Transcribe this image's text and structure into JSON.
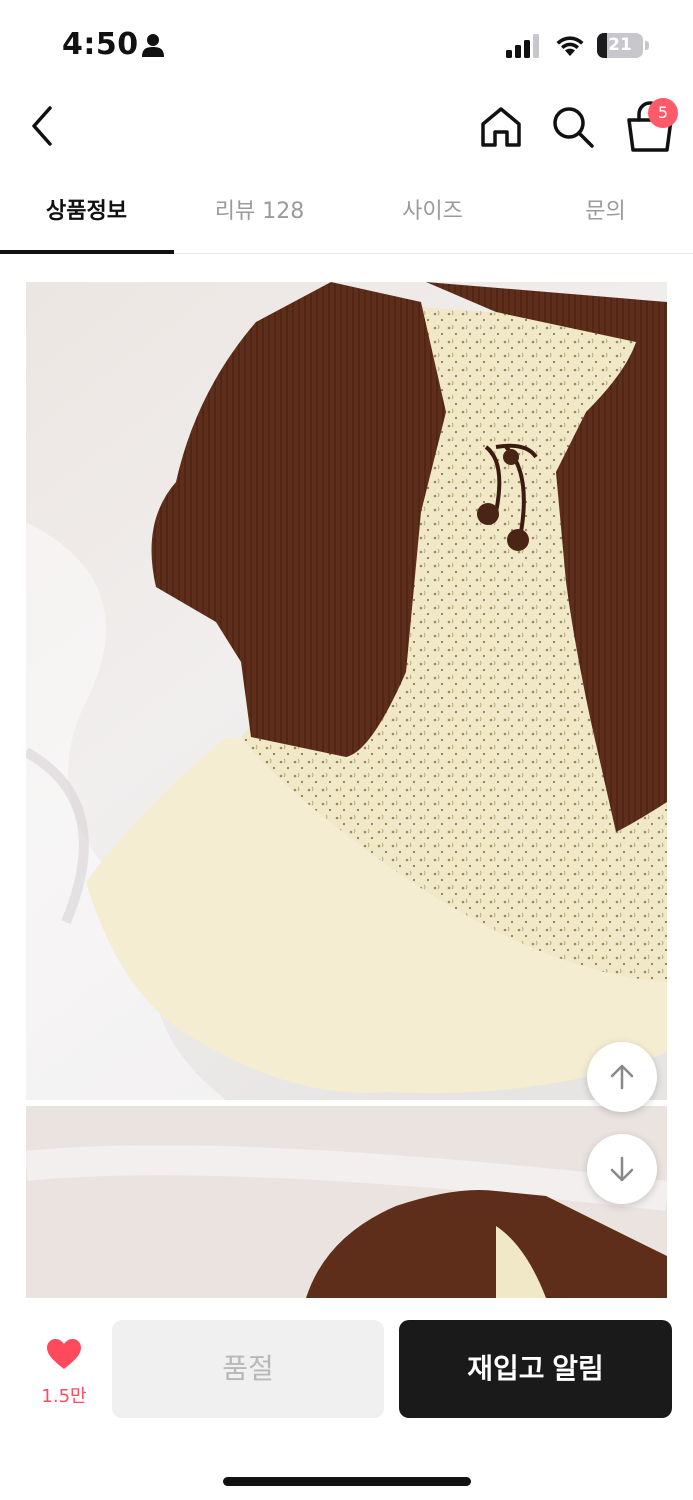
{
  "status_bar": {
    "time": "4:50",
    "battery": "21",
    "battery_level": 0.21
  },
  "nav": {
    "back_icon": "chevron-left-icon",
    "home_icon": "home-icon",
    "search_icon": "search-icon",
    "cart_icon": "shopping-bag-icon",
    "cart_badge": "5"
  },
  "tabs": [
    {
      "label": "상품정보",
      "active": true
    },
    {
      "label": "리뷰 128",
      "active": false
    },
    {
      "label": "사이즈",
      "active": false
    },
    {
      "label": "문의",
      "active": false
    }
  ],
  "bottom_bar": {
    "like_count": "1.5만",
    "soldout_label": "품절",
    "restock_label": "재입고 알림"
  },
  "colors": {
    "accent": "#ff4a5e",
    "primary_button": "#1a1a1a",
    "disabled_button": "#f0f0f0"
  }
}
